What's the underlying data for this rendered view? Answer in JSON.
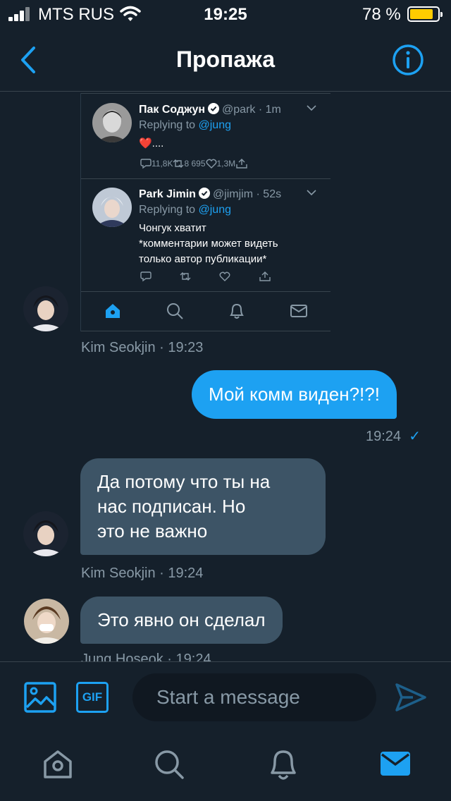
{
  "status_bar": {
    "carrier": "MTS RUS",
    "time": "19:25",
    "battery_percent": "78 %"
  },
  "header": {
    "title": "Пропажа"
  },
  "embedded_tweets": [
    {
      "name": "Пак Соджун",
      "handle": "@park",
      "time": "· 1m",
      "replying_prefix": "Replying to",
      "replying_to": "@jung",
      "text": "❤️....",
      "replies": "11,8K",
      "retweets": "8 695",
      "likes": "1,3M"
    },
    {
      "name": "Park Jimin",
      "handle": "@jimjim",
      "time": "· 52s",
      "replying_prefix": "Replying to",
      "replying_to": "@jung",
      "text_lines": [
        "Чонгук хватит",
        "*комментарии может видеть",
        "только автор публикации*"
      ]
    }
  ],
  "messages": [
    {
      "meta": "Kim Seokjin · 19:23"
    },
    {
      "text": "Мой комм виден?!?!",
      "meta_time": "19:24",
      "meta_check": "✓"
    },
    {
      "text_lines": [
        "Да потому что ты на",
        "нас подписан. Но",
        "это не важно"
      ],
      "meta": "Kim Seokjin · 19:24"
    },
    {
      "text": "Это явно он сделал",
      "meta": "Jung Hoseok · 19:24"
    }
  ],
  "composer": {
    "gif_label": "GIF",
    "placeholder": "Start a message"
  },
  "colors": {
    "background": "#15202b",
    "accent": "#1da1f2",
    "incoming_bubble": "#3d5466",
    "muted_text": "#8899a6"
  },
  "icons": [
    "signal-icon",
    "wifi-icon",
    "battery-icon",
    "back-arrow-icon",
    "info-icon",
    "verified-icon",
    "chevron-down-icon",
    "reply-icon",
    "retweet-icon",
    "like-icon",
    "share-icon",
    "home-icon",
    "search-icon",
    "notifications-icon",
    "messages-icon",
    "image-icon",
    "gif-icon",
    "send-icon"
  ]
}
